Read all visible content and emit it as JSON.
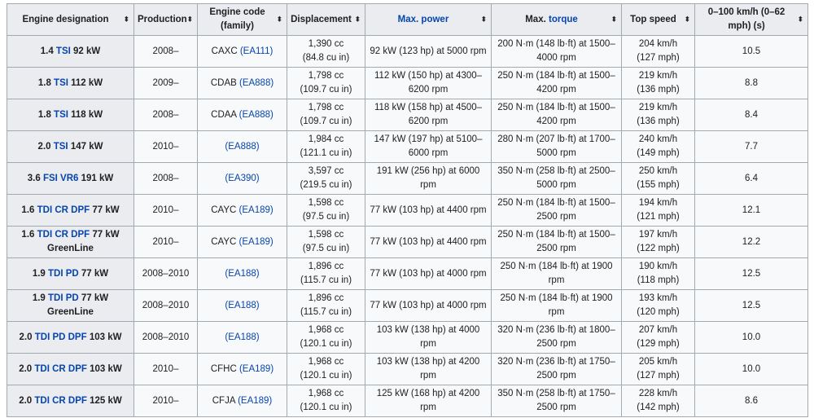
{
  "headers": {
    "engine": "Engine designation",
    "production": "Production",
    "code_line1": "Engine code",
    "code_line2": "(family)",
    "displacement": "Displacement",
    "power": "Max. power",
    "torque_prefix": "Max. ",
    "torque_link": "torque",
    "speed": "Top speed",
    "accel": "0–100 km/h (0–62 mph) (s)"
  },
  "sort_icon": "sort-updown-icon",
  "link_color": "#0645ad",
  "rows": [
    {
      "e_pre": "1.4 ",
      "e_link": "TSI",
      "e_post": " 92 kW",
      "prod": "2008–",
      "code": "CAXC ",
      "family": "(EA111)",
      "disp1": "1,390 cc",
      "disp2": "(84.8 cu in)",
      "power": "92 kW (123 hp) at 5000 rpm",
      "torque": "200 N·m (148 lb·ft) at 1500–4000 rpm",
      "speed1": "204 km/h",
      "speed2": "(127 mph)",
      "accel": "10.5"
    },
    {
      "e_pre": "1.8 ",
      "e_link": "TSI",
      "e_post": " 112 kW",
      "prod": "2009–",
      "code": "CDAB ",
      "family": "(EA888)",
      "disp1": "1,798 cc",
      "disp2": "(109.7 cu in)",
      "power": "112 kW (150 hp) at 4300–6200 rpm",
      "torque": "250 N·m (184 lb·ft) at 1500–4200 rpm",
      "speed1": "219 km/h",
      "speed2": "(136 mph)",
      "accel": "8.8"
    },
    {
      "e_pre": "1.8 ",
      "e_link": "TSI",
      "e_post": " 118 kW",
      "prod": "2008–",
      "code": "CDAA ",
      "family": "(EA888)",
      "disp1": "1,798 cc",
      "disp2": "(109.7 cu in)",
      "power": "118 kW (158 hp) at 4500–6200 rpm",
      "torque": "250 N·m (184 lb·ft) at 1500–4200 rpm",
      "speed1": "219 km/h",
      "speed2": "(136 mph)",
      "accel": "8.4"
    },
    {
      "e_pre": "2.0 ",
      "e_link": "TSI",
      "e_post": " 147 kW",
      "prod": "2010–",
      "code": "",
      "family": "(EA888)",
      "disp1": "1,984 cc",
      "disp2": "(121.1 cu in)",
      "power": "147 kW (197 hp) at 5100–6000 rpm",
      "torque": "280 N·m (207 lb·ft) at 1700–5000 rpm",
      "speed1": "240 km/h",
      "speed2": "(149 mph)",
      "accel": "7.7"
    },
    {
      "e_pre": "3.6 ",
      "e_link": "FSI VR6",
      "e_post": " 191 kW",
      "prod": "2008–",
      "code": "",
      "family": "(EA390)",
      "disp1": "3,597 cc",
      "disp2": "(219.5 cu in)",
      "power": "191 kW (256 hp) at 6000 rpm",
      "torque": "350 N·m (258 lb·ft) at 2500–5000 rpm",
      "speed1": "250 km/h",
      "speed2": "(155 mph)",
      "accel": "6.4"
    },
    {
      "e_pre": "1.6 ",
      "e_link": "TDI CR DPF",
      "e_post": " 77 kW",
      "prod": "2010–",
      "code": "CAYC ",
      "family": "(EA189)",
      "disp1": "1,598 cc",
      "disp2": "(97.5 cu in)",
      "power": "77 kW (103 hp) at 4400 rpm",
      "torque": "250 N·m (184 lb·ft) at 1500–2500 rpm",
      "speed1": "194 km/h",
      "speed2": "(121 mph)",
      "accel": "12.1"
    },
    {
      "e_pre": "1.6 ",
      "e_link": "TDI CR DPF",
      "e_post": " 77 kW GreenLine",
      "prod": "2010–",
      "code": "CAYC ",
      "family": "(EA189)",
      "disp1": "1,598 cc",
      "disp2": "(97.5 cu in)",
      "power": "77 kW (103 hp) at 4400 rpm",
      "torque": "250 N·m (184 lb·ft) at 1500–2500 rpm",
      "speed1": "197 km/h",
      "speed2": "(122 mph)",
      "accel": "12.2"
    },
    {
      "e_pre": "1.9 ",
      "e_link": "TDI PD",
      "e_post": " 77 kW",
      "prod": "2008–2010",
      "code": "",
      "family": "(EA188)",
      "disp1": "1,896 cc",
      "disp2": "(115.7 cu in)",
      "power": "77 kW (103 hp) at 4000 rpm",
      "torque": "250 N·m (184 lb·ft) at 1900 rpm",
      "speed1": "190 km/h",
      "speed2": "(118 mph)",
      "accel": "12.5"
    },
    {
      "e_pre": "1.9 ",
      "e_link": "TDI PD",
      "e_post": " 77 kW GreenLine",
      "prod": "2008–2010",
      "code": "",
      "family": "(EA188)",
      "disp1": "1,896 cc",
      "disp2": "(115.7 cu in)",
      "power": "77 kW (103 hp) at 4000 rpm",
      "torque": "250 N·m (184 lb·ft) at 1900 rpm",
      "speed1": "193 km/h",
      "speed2": "(120 mph)",
      "accel": "12.5"
    },
    {
      "e_pre": "2.0 ",
      "e_link": "TDI PD DPF",
      "e_post": " 103 kW",
      "prod": "2008–2010",
      "code": "",
      "family": "(EA188)",
      "disp1": "1,968 cc",
      "disp2": "(120.1 cu in)",
      "power": "103 kW (138 hp) at 4000 rpm",
      "torque": "320 N·m (236 lb·ft) at 1800–2500 rpm",
      "speed1": "207 km/h",
      "speed2": "(129 mph)",
      "accel": "10.0"
    },
    {
      "e_pre": "2.0 ",
      "e_link": "TDI CR DPF",
      "e_post": " 103 kW",
      "prod": "2010–",
      "code": "CFHC ",
      "family": "(EA189)",
      "disp1": "1,968 cc",
      "disp2": "(120.1 cu in)",
      "power": "103 kW (138 hp) at 4200 rpm",
      "torque": "320 N·m (236 lb·ft) at 1750–2500 rpm",
      "speed1": "205 km/h",
      "speed2": "(127 mph)",
      "accel": "10.0"
    },
    {
      "e_pre": "2.0 ",
      "e_link": "TDI CR DPF",
      "e_post": " 125 kW",
      "prod": "2010–",
      "code": "CFJA ",
      "family": "(EA189)",
      "disp1": "1,968 cc",
      "disp2": "(120.1 cu in)",
      "power": "125 kW (168 hp) at 4200 rpm",
      "torque": "350 N·m (258 lb·ft) at 1750–2500 rpm",
      "speed1": "228 km/h",
      "speed2": "(142 mph)",
      "accel": "8.6"
    }
  ]
}
